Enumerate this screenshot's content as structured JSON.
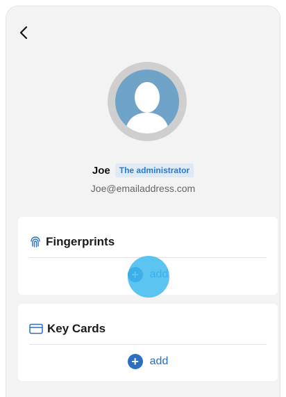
{
  "header": {
    "back_icon": "chevron-left-icon"
  },
  "profile": {
    "name": "Joe",
    "role": "The administrator",
    "email": "Joe@emailaddress.com",
    "avatar_icon": "user-avatar-icon"
  },
  "sections": {
    "fingerprints": {
      "title": "Fingerprints",
      "icon": "fingerprint-icon",
      "add_label": "add"
    },
    "key_cards": {
      "title": "Key Cards",
      "icon": "card-icon",
      "add_label": "add"
    }
  },
  "colors": {
    "accent": "#2a6fc0",
    "role_text": "#2a7bd0",
    "role_bg": "#dfeaf4",
    "avatar_bg": "#6fa3c8",
    "tap_highlight": "#40baee"
  }
}
